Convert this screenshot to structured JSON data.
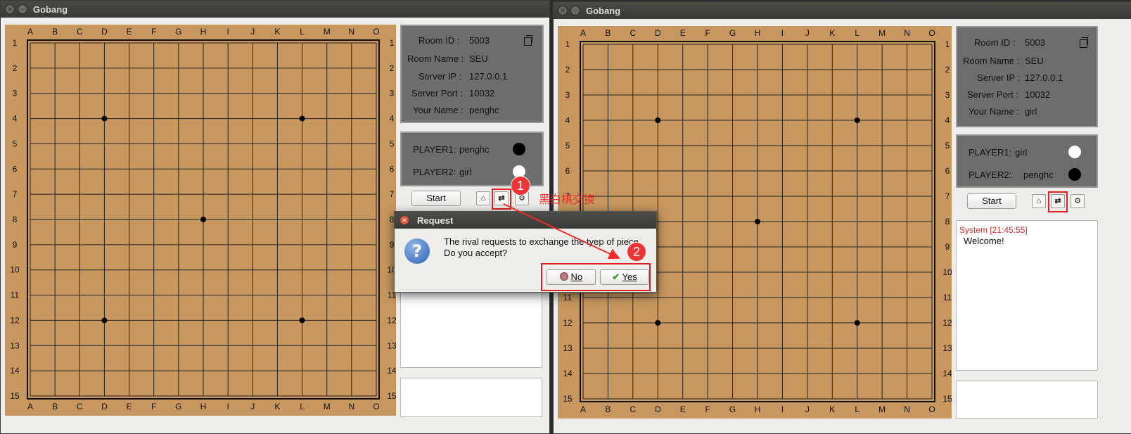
{
  "app": {
    "title": "Gobang"
  },
  "board": {
    "columns": [
      "A",
      "B",
      "C",
      "D",
      "E",
      "F",
      "G",
      "H",
      "I",
      "J",
      "K",
      "L",
      "M",
      "N",
      "O"
    ],
    "rows": [
      "1",
      "2",
      "3",
      "4",
      "5",
      "6",
      "7",
      "8",
      "9",
      "10",
      "11",
      "12",
      "13",
      "14",
      "15"
    ],
    "star_points": [
      "D4",
      "L4",
      "H8",
      "D12",
      "L12"
    ]
  },
  "left_window": {
    "info": {
      "room_id_label": "Room  ID :",
      "room_id": "5003",
      "room_name_label": "Room Name :",
      "room_name": "SEU",
      "server_ip_label": "Server IP :",
      "server_ip": "127.0.0.1",
      "server_port_label": "Server Port :",
      "server_port": "10032",
      "your_name_label": "Your Name :",
      "your_name": "penghc"
    },
    "players": {
      "p1_label": "PLAYER1:",
      "p1_name": "penghc",
      "p1_color": "black",
      "p2_label": "PLAYER2:",
      "p2_name": "girl",
      "p2_color": "white"
    },
    "start_label": "Start"
  },
  "right_window": {
    "info": {
      "room_id_label": "Room  ID :",
      "room_id": "5003",
      "room_name_label": "Room Name :",
      "room_name": "SEU",
      "server_ip_label": "Server IP :",
      "server_ip": "127.0.0.1",
      "server_port_label": "Server Port :",
      "server_port": "10032",
      "your_name_label": "Your Name :",
      "your_name": "girl"
    },
    "players": {
      "p1_label": "PLAYER1:",
      "p1_name": "girl",
      "p1_color": "white",
      "p2_label": "PLAYER2:",
      "p2_name": "penghc",
      "p2_color": "black"
    },
    "start_label": "Start",
    "chat": {
      "sender": "System [21:45:55]",
      "message": "Welcome!"
    }
  },
  "dialog": {
    "title": "Request",
    "line1": "The rival requests to exchange the tyep of piece.",
    "line2": "Do you accept?",
    "no_label": "No",
    "yes_label": "Yes"
  },
  "annotations": {
    "badge1": "1",
    "badge2": "2",
    "note": "黑白棋交换",
    "color": "#ef2a2a"
  }
}
